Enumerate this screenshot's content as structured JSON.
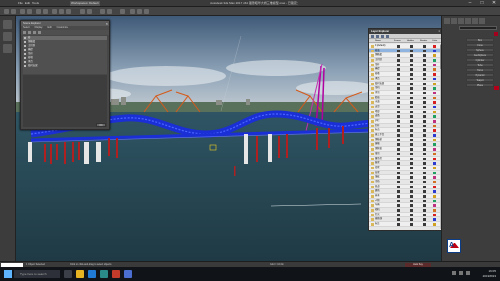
{
  "app": {
    "title": "Autodesk 3ds Max 2017 x64  湘潭昭华大桥三维模型.max  - 已锁定：",
    "workspace": "Workspaces: Default",
    "menu": [
      "File",
      "Edit",
      "Tools",
      "Group",
      "Views",
      "Create",
      "Modifiers",
      "Animation",
      "Graph Editors",
      "Rendering",
      "Civil View",
      "Customize",
      "Scripting",
      "Help"
    ]
  },
  "explorer": {
    "title": "Scene Explorer",
    "menu": [
      "Select",
      "Display",
      "Edit",
      "Customize"
    ],
    "items": [
      "桥",
      "钢箱梁",
      "主拱肋",
      "横撑",
      "吊杆",
      "桥墩",
      "承台",
      "临时支架"
    ]
  },
  "layer_panel": {
    "title": "Layer Explorer",
    "headers": [
      "Name",
      "Frozen",
      "Hidden",
      "Render",
      "Color"
    ],
    "rows": [
      "0 (default)",
      "桥面",
      "钢箱梁",
      "主拱肋",
      "吊杆",
      "横撑",
      "桥墩",
      "承台",
      "临时支架",
      "吊机",
      "浮吊",
      "船舶",
      "水面",
      "天空",
      "地形",
      "道路",
      "护栏",
      "灯杆",
      "标志",
      "施工平台",
      "钢栈桥",
      "围堰",
      "钢管桩",
      "塔吊",
      "履带吊",
      "缆索",
      "扣索",
      "拉索",
      "锚碇",
      "引桥",
      "匝道",
      "建筑",
      "树木",
      "人物",
      "车辆",
      "相机",
      "灯光",
      "辅助线",
      "标注"
    ],
    "swatches": [
      "#d92020",
      "#2b3bd1",
      "#d0a020",
      "#20a060",
      "#c03080",
      "#d07020"
    ]
  },
  "command_panel": {
    "buttons": [
      "Box",
      "Cone",
      "Sphere",
      "GeoSphere",
      "Cylinder",
      "Tube",
      "Torus",
      "Pyramid",
      "Teapot",
      "Plane"
    ]
  },
  "status": {
    "selected": "1 Object Selected",
    "hint": "Click or click-and-drag to select objects",
    "grid": "Grid = 10.0m",
    "key": "Auto Key"
  },
  "taskbar": {
    "search": "Type here to search",
    "time": "16:05",
    "date": "2019/8/23"
  },
  "colors": {
    "bridge": "#1b2fd6",
    "arch_highlight": "#b000a0",
    "crane": "#d55a1a",
    "piers": "#b02020",
    "water": "#2a4a55"
  }
}
